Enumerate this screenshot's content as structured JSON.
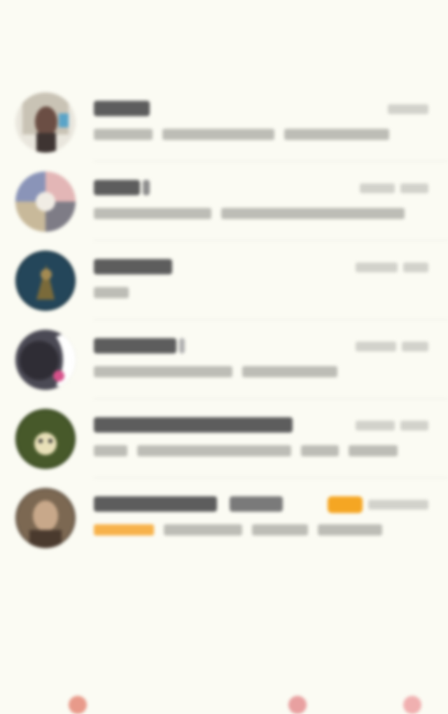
{
  "header": {
    "title": ""
  },
  "colors": {
    "background": "#fbfbf3",
    "accent_orange": "#f5a623",
    "name_text": "#5d5d5d",
    "preview_text": "#bdbdb6"
  },
  "conversations": [
    {
      "name": "",
      "time": "",
      "preview": "",
      "unread": false
    },
    {
      "name": "",
      "time": "",
      "preview": "",
      "unread": false
    },
    {
      "name": "",
      "time": "",
      "preview": "",
      "unread": false
    },
    {
      "name": "",
      "time": "",
      "preview": "",
      "unread": false
    },
    {
      "name": "",
      "time": "",
      "preview": "",
      "unread": false
    },
    {
      "name": "",
      "time": "",
      "preview": "",
      "unread": true
    }
  ],
  "bottom_nav": {
    "items": [
      "",
      "",
      "",
      ""
    ]
  }
}
